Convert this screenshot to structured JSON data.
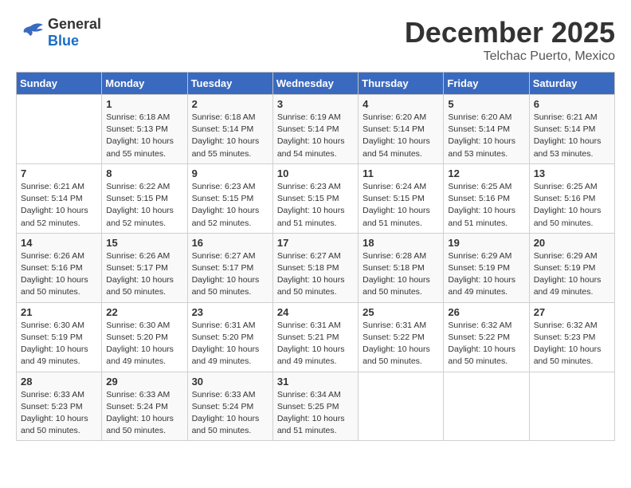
{
  "logo": {
    "line1": "General",
    "line2": "Blue"
  },
  "title": "December 2025",
  "location": "Telchac Puerto, Mexico",
  "headers": [
    "Sunday",
    "Monday",
    "Tuesday",
    "Wednesday",
    "Thursday",
    "Friday",
    "Saturday"
  ],
  "weeks": [
    [
      {
        "day": "",
        "sunrise": "",
        "sunset": "",
        "daylight": ""
      },
      {
        "day": "1",
        "sunrise": "Sunrise: 6:18 AM",
        "sunset": "Sunset: 5:13 PM",
        "daylight": "Daylight: 10 hours and 55 minutes."
      },
      {
        "day": "2",
        "sunrise": "Sunrise: 6:18 AM",
        "sunset": "Sunset: 5:14 PM",
        "daylight": "Daylight: 10 hours and 55 minutes."
      },
      {
        "day": "3",
        "sunrise": "Sunrise: 6:19 AM",
        "sunset": "Sunset: 5:14 PM",
        "daylight": "Daylight: 10 hours and 54 minutes."
      },
      {
        "day": "4",
        "sunrise": "Sunrise: 6:20 AM",
        "sunset": "Sunset: 5:14 PM",
        "daylight": "Daylight: 10 hours and 54 minutes."
      },
      {
        "day": "5",
        "sunrise": "Sunrise: 6:20 AM",
        "sunset": "Sunset: 5:14 PM",
        "daylight": "Daylight: 10 hours and 53 minutes."
      },
      {
        "day": "6",
        "sunrise": "Sunrise: 6:21 AM",
        "sunset": "Sunset: 5:14 PM",
        "daylight": "Daylight: 10 hours and 53 minutes."
      }
    ],
    [
      {
        "day": "7",
        "sunrise": "Sunrise: 6:21 AM",
        "sunset": "Sunset: 5:14 PM",
        "daylight": "Daylight: 10 hours and 52 minutes."
      },
      {
        "day": "8",
        "sunrise": "Sunrise: 6:22 AM",
        "sunset": "Sunset: 5:15 PM",
        "daylight": "Daylight: 10 hours and 52 minutes."
      },
      {
        "day": "9",
        "sunrise": "Sunrise: 6:23 AM",
        "sunset": "Sunset: 5:15 PM",
        "daylight": "Daylight: 10 hours and 52 minutes."
      },
      {
        "day": "10",
        "sunrise": "Sunrise: 6:23 AM",
        "sunset": "Sunset: 5:15 PM",
        "daylight": "Daylight: 10 hours and 51 minutes."
      },
      {
        "day": "11",
        "sunrise": "Sunrise: 6:24 AM",
        "sunset": "Sunset: 5:15 PM",
        "daylight": "Daylight: 10 hours and 51 minutes."
      },
      {
        "day": "12",
        "sunrise": "Sunrise: 6:25 AM",
        "sunset": "Sunset: 5:16 PM",
        "daylight": "Daylight: 10 hours and 51 minutes."
      },
      {
        "day": "13",
        "sunrise": "Sunrise: 6:25 AM",
        "sunset": "Sunset: 5:16 PM",
        "daylight": "Daylight: 10 hours and 50 minutes."
      }
    ],
    [
      {
        "day": "14",
        "sunrise": "Sunrise: 6:26 AM",
        "sunset": "Sunset: 5:16 PM",
        "daylight": "Daylight: 10 hours and 50 minutes."
      },
      {
        "day": "15",
        "sunrise": "Sunrise: 6:26 AM",
        "sunset": "Sunset: 5:17 PM",
        "daylight": "Daylight: 10 hours and 50 minutes."
      },
      {
        "day": "16",
        "sunrise": "Sunrise: 6:27 AM",
        "sunset": "Sunset: 5:17 PM",
        "daylight": "Daylight: 10 hours and 50 minutes."
      },
      {
        "day": "17",
        "sunrise": "Sunrise: 6:27 AM",
        "sunset": "Sunset: 5:18 PM",
        "daylight": "Daylight: 10 hours and 50 minutes."
      },
      {
        "day": "18",
        "sunrise": "Sunrise: 6:28 AM",
        "sunset": "Sunset: 5:18 PM",
        "daylight": "Daylight: 10 hours and 50 minutes."
      },
      {
        "day": "19",
        "sunrise": "Sunrise: 6:29 AM",
        "sunset": "Sunset: 5:19 PM",
        "daylight": "Daylight: 10 hours and 49 minutes."
      },
      {
        "day": "20",
        "sunrise": "Sunrise: 6:29 AM",
        "sunset": "Sunset: 5:19 PM",
        "daylight": "Daylight: 10 hours and 49 minutes."
      }
    ],
    [
      {
        "day": "21",
        "sunrise": "Sunrise: 6:30 AM",
        "sunset": "Sunset: 5:19 PM",
        "daylight": "Daylight: 10 hours and 49 minutes."
      },
      {
        "day": "22",
        "sunrise": "Sunrise: 6:30 AM",
        "sunset": "Sunset: 5:20 PM",
        "daylight": "Daylight: 10 hours and 49 minutes."
      },
      {
        "day": "23",
        "sunrise": "Sunrise: 6:31 AM",
        "sunset": "Sunset: 5:20 PM",
        "daylight": "Daylight: 10 hours and 49 minutes."
      },
      {
        "day": "24",
        "sunrise": "Sunrise: 6:31 AM",
        "sunset": "Sunset: 5:21 PM",
        "daylight": "Daylight: 10 hours and 49 minutes."
      },
      {
        "day": "25",
        "sunrise": "Sunrise: 6:31 AM",
        "sunset": "Sunset: 5:22 PM",
        "daylight": "Daylight: 10 hours and 50 minutes."
      },
      {
        "day": "26",
        "sunrise": "Sunrise: 6:32 AM",
        "sunset": "Sunset: 5:22 PM",
        "daylight": "Daylight: 10 hours and 50 minutes."
      },
      {
        "day": "27",
        "sunrise": "Sunrise: 6:32 AM",
        "sunset": "Sunset: 5:23 PM",
        "daylight": "Daylight: 10 hours and 50 minutes."
      }
    ],
    [
      {
        "day": "28",
        "sunrise": "Sunrise: 6:33 AM",
        "sunset": "Sunset: 5:23 PM",
        "daylight": "Daylight: 10 hours and 50 minutes."
      },
      {
        "day": "29",
        "sunrise": "Sunrise: 6:33 AM",
        "sunset": "Sunset: 5:24 PM",
        "daylight": "Daylight: 10 hours and 50 minutes."
      },
      {
        "day": "30",
        "sunrise": "Sunrise: 6:33 AM",
        "sunset": "Sunset: 5:24 PM",
        "daylight": "Daylight: 10 hours and 50 minutes."
      },
      {
        "day": "31",
        "sunrise": "Sunrise: 6:34 AM",
        "sunset": "Sunset: 5:25 PM",
        "daylight": "Daylight: 10 hours and 51 minutes."
      },
      {
        "day": "",
        "sunrise": "",
        "sunset": "",
        "daylight": ""
      },
      {
        "day": "",
        "sunrise": "",
        "sunset": "",
        "daylight": ""
      },
      {
        "day": "",
        "sunrise": "",
        "sunset": "",
        "daylight": ""
      }
    ]
  ]
}
